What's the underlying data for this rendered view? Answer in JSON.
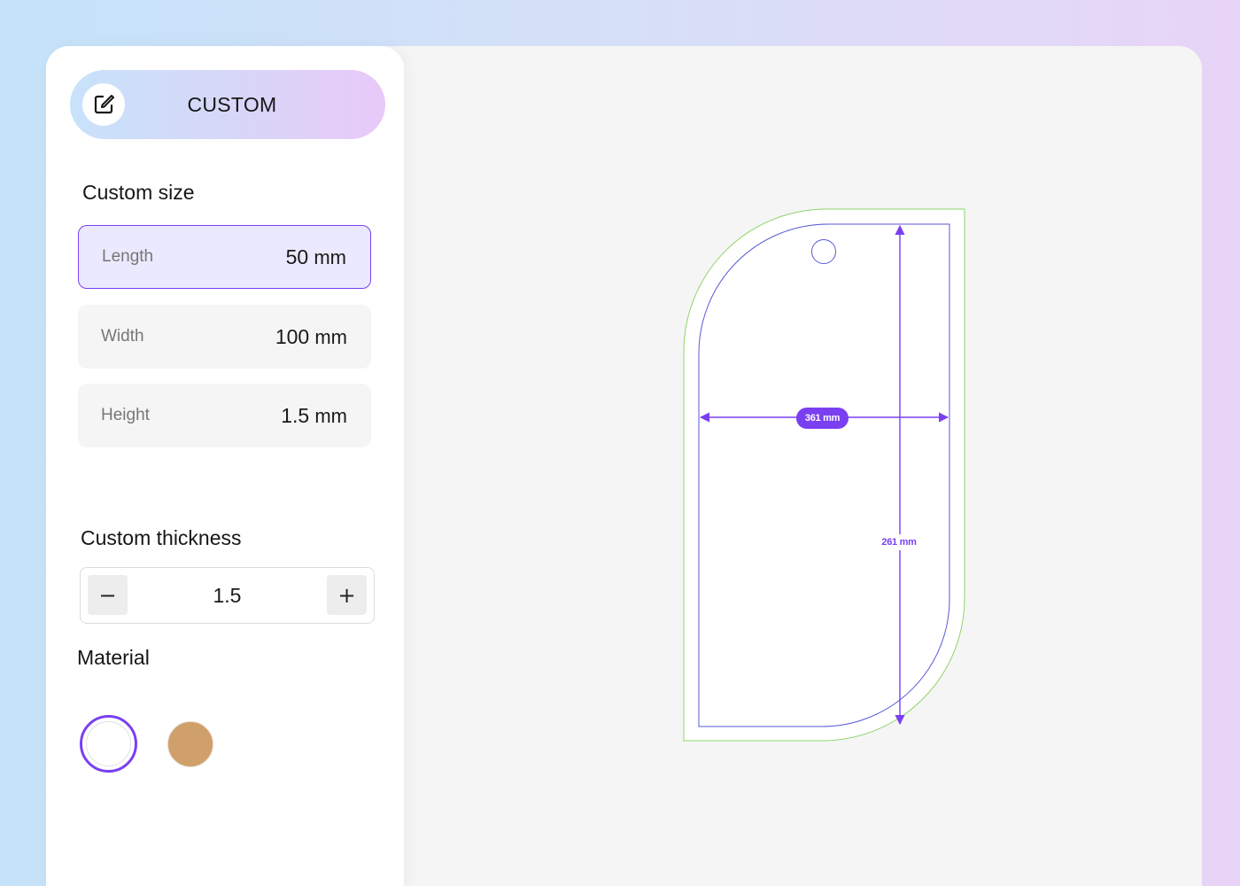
{
  "mode": {
    "label": "CUSTOM",
    "icon": "edit-icon"
  },
  "custom_size": {
    "title": "Custom size",
    "fields": [
      {
        "label": "Length",
        "value": "50",
        "unit": "mm",
        "active": true
      },
      {
        "label": "Width",
        "value": "100",
        "unit": "mm",
        "active": false
      },
      {
        "label": "Height",
        "value": "1.5",
        "unit": "mm",
        "active": false
      }
    ]
  },
  "custom_thickness": {
    "title": "Custom thickness",
    "value": "1.5",
    "decrement_symbol": "−",
    "increment_symbol": "+"
  },
  "material": {
    "title": "Material",
    "swatches": [
      {
        "name": "white",
        "color": "#ffffff",
        "selected": true
      },
      {
        "name": "wood",
        "color": "#cfa06a",
        "selected": false
      }
    ]
  },
  "preview": {
    "width_label": "361 mm",
    "height_label": "261 mm",
    "colors": {
      "accent": "#7b3ff2",
      "bleed": "#8fd46a",
      "trim": "#5a5ad6"
    }
  }
}
